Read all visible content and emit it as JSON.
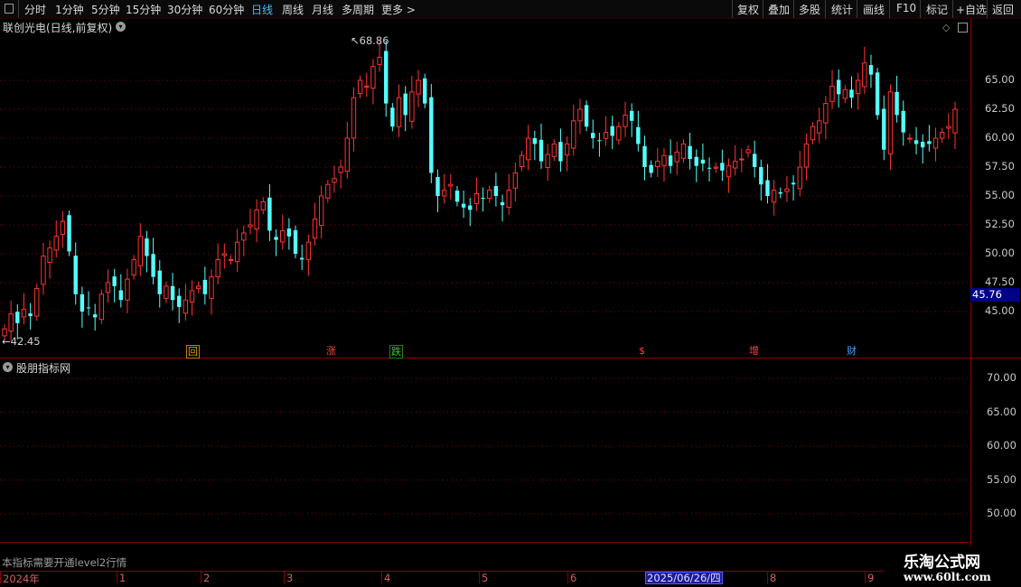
{
  "toolbar": {
    "periods": [
      "分时",
      "1分钟",
      "5分钟",
      "15分钟",
      "30分钟",
      "60分钟",
      "日线",
      "周线",
      "月线",
      "多周期",
      "更多 >"
    ],
    "active_period": "日线",
    "right_buttons": [
      "复权",
      "叠加",
      "多股",
      "统计",
      "画线",
      "F10",
      "标记",
      "+自选",
      "返回"
    ]
  },
  "chart": {
    "title": "联创光电(日线,前复权)",
    "high_label": "68.86",
    "low_label": "42.45",
    "current_price": "45.76",
    "price_ticks": [
      "65.00",
      "62.50",
      "60.00",
      "57.50",
      "55.00",
      "52.50",
      "50.00",
      "47.50",
      "45.00"
    ],
    "events": [
      {
        "label": "回",
        "color": "#e0a000",
        "box": "#c08000"
      },
      {
        "label": "涨",
        "color": "#ff4040",
        "box": ""
      },
      {
        "label": "跌",
        "color": "#30d030",
        "box": "#208020"
      },
      {
        "label": "$",
        "color": "#ff4040",
        "box": ""
      },
      {
        "label": "增",
        "color": "#ff4040",
        "box": ""
      },
      {
        "label": "财",
        "color": "#40a0ff",
        "box": ""
      }
    ],
    "colors": {
      "up": "#ff3232",
      "down": "#54ffff",
      "grid": "#8b0000",
      "axis_text": "#c9c9c9"
    }
  },
  "indicator": {
    "title": "股朋指标网",
    "ticks": [
      "70.00",
      "65.00",
      "60.00",
      "55.00",
      "50.00"
    ],
    "notice": "本指标需要开通level2行情"
  },
  "date_axis": {
    "labels": [
      "2024年",
      "1",
      "2",
      "3",
      "4",
      "5",
      "6",
      "8",
      "9"
    ],
    "cursor_date": "2025/06/26/四"
  },
  "watermark": {
    "line1": "乐淘公式网",
    "line2": "www.60lt.com"
  },
  "chart_data": {
    "type": "candlestick",
    "title": "联创光电(日线,前复权)",
    "ylim": [
      42.0,
      69.5
    ],
    "yticks": [
      45.0,
      47.5,
      50.0,
      52.5,
      55.0,
      57.5,
      60.0,
      62.5,
      65.0
    ],
    "period_labels": [
      "2024年",
      "1",
      "2",
      "3",
      "4",
      "5",
      "6",
      "8",
      "9"
    ],
    "annotated_high": 68.86,
    "annotated_low": 42.45,
    "last_price": 45.76,
    "close_series": [
      43.5,
      44.8,
      44.0,
      45.2,
      44.6,
      47.0,
      49.8,
      50.5,
      51.5,
      52.8,
      50.2,
      46.5,
      45.0,
      45.3,
      44.5,
      46.5,
      47.5,
      47.2,
      46.0,
      47.8,
      49.5,
      51.5,
      49.8,
      48.0,
      46.5,
      47.2,
      46.0,
      45.4,
      46.0,
      46.8,
      47.2,
      46.5,
      48.0,
      49.5,
      50.0,
      49.5,
      51.0,
      51.8,
      52.5,
      53.8,
      54.5,
      52.0,
      51.2,
      52.0,
      51.5,
      50.0,
      49.5,
      51.0,
      53.0,
      55.0,
      56.0,
      56.5,
      57.5,
      60.0,
      63.5,
      65.0,
      64.5,
      66.2,
      67.0,
      63.0,
      61.0,
      63.5,
      62.0,
      64.0,
      65.0,
      63.0,
      57.0,
      55.0,
      55.5,
      56.0,
      54.5,
      54.0,
      53.8,
      55.2,
      54.8,
      55.5,
      55.0,
      54.2,
      55.5,
      57.0,
      58.5,
      60.0,
      59.5,
      58.0,
      58.6,
      59.5,
      58.0,
      59.5,
      61.5,
      62.5,
      61.0,
      60.0,
      59.8,
      60.5,
      60.2,
      61.0,
      62.0,
      61.5,
      59.5,
      57.5,
      57.0,
      58.0,
      58.5,
      57.6,
      58.8,
      59.5,
      58.2,
      57.6,
      57.8,
      57.4,
      57.5,
      57.2,
      57.6,
      58.0,
      58.2,
      59.0,
      57.5,
      56.0,
      55.0,
      55.5,
      55.2,
      55.6,
      56.0,
      57.5,
      59.5,
      61.0,
      61.5,
      63.0,
      64.5,
      63.8,
      64.2,
      63.5,
      65.0,
      66.5,
      65.5,
      62.0,
      59.0,
      64.0,
      62.0,
      60.5,
      60.0,
      59.5,
      59.2,
      59.5,
      60.0,
      60.5,
      61.0,
      62.5
    ]
  }
}
